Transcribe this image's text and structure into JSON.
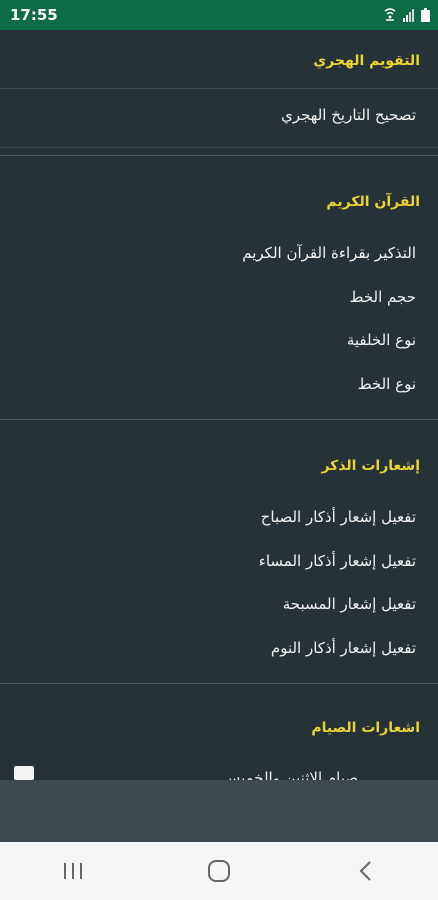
{
  "status_bar": {
    "time": "17:55",
    "icons": [
      "wifi-calling-icon",
      "signal-icon",
      "battery-icon"
    ]
  },
  "sections": {
    "hijri": {
      "title": "التقويم الهجري",
      "items": [
        "تصحيح التاريخ الهجري"
      ]
    },
    "quran": {
      "title": "القرآن الكريم",
      "items": [
        "التذكير بقراءة القرآن الكريم",
        "حجم الخط",
        "نوع الخلفية",
        "نوع الخط"
      ]
    },
    "dhikr": {
      "title": "إشعارات الذكر",
      "items": [
        "تفعيل إشعار أذكار الصباح",
        "تفعيل إشعار أذكار المساء",
        "تفعيل إشعار المسبحة",
        "تفعيل إشعار أذكار النوم"
      ]
    },
    "fasting": {
      "title": "اشعارات الصيام",
      "peek_item": "صيام الاثنين والخميس",
      "peek_checked": true
    }
  },
  "colors": {
    "status_bar": "#0d6b46",
    "background": "#263238",
    "section_title": "#e9d530",
    "item_text": "#f2f2f2",
    "bottom_panel": "#3f4a50",
    "nav_bar": "#f6f6f6"
  },
  "nav_bar": {
    "buttons": [
      "recent-apps-icon",
      "home-icon",
      "back-icon"
    ]
  }
}
